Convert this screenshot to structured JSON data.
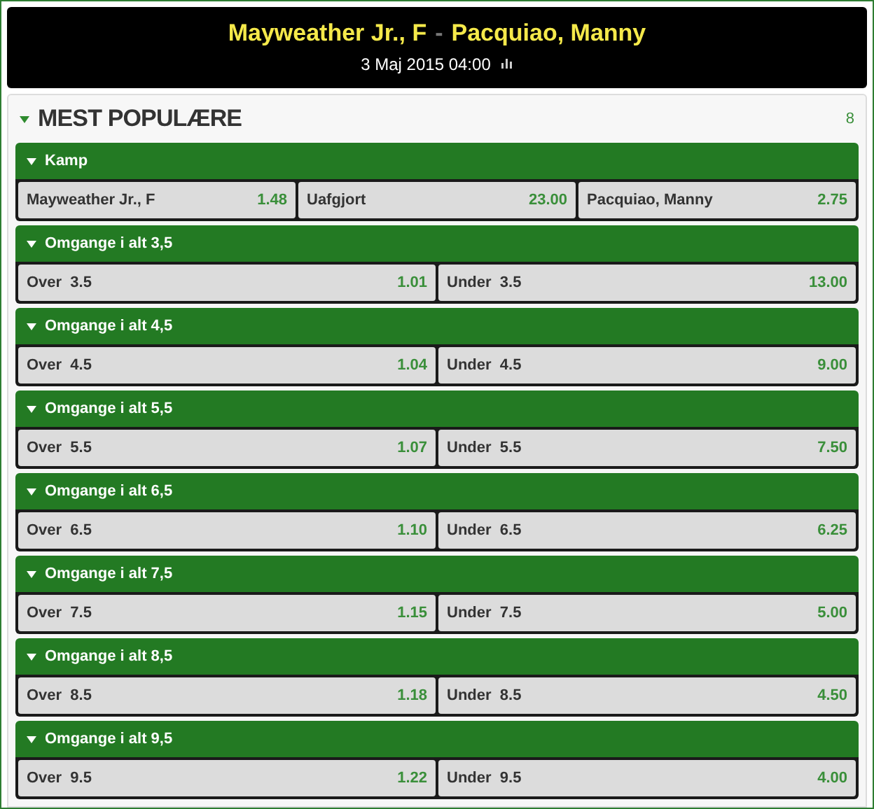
{
  "event": {
    "home": "Mayweather Jr., F",
    "separator": "-",
    "away": "Pacquiao, Manny",
    "date": "3 Maj 2015 04:00"
  },
  "section": {
    "title": "MEST POPULÆRE",
    "count": "8",
    "expanded": true
  },
  "markets": [
    {
      "title": "Kamp",
      "expanded": true,
      "outcomes": [
        {
          "label": "Mayweather Jr., F",
          "odds": "1.48"
        },
        {
          "label": "Uafgjort",
          "odds": "23.00"
        },
        {
          "label": "Pacquiao, Manny",
          "odds": "2.75"
        }
      ]
    },
    {
      "title": "Omgange i alt 3,5",
      "expanded": true,
      "outcomes": [
        {
          "label": "Over  3.5",
          "odds": "1.01"
        },
        {
          "label": "Under  3.5",
          "odds": "13.00"
        }
      ]
    },
    {
      "title": "Omgange i alt 4,5",
      "expanded": true,
      "outcomes": [
        {
          "label": "Over  4.5",
          "odds": "1.04"
        },
        {
          "label": "Under  4.5",
          "odds": "9.00"
        }
      ]
    },
    {
      "title": "Omgange i alt 5,5",
      "expanded": true,
      "outcomes": [
        {
          "label": "Over  5.5",
          "odds": "1.07"
        },
        {
          "label": "Under  5.5",
          "odds": "7.50"
        }
      ]
    },
    {
      "title": "Omgange i alt 6,5",
      "expanded": true,
      "outcomes": [
        {
          "label": "Over  6.5",
          "odds": "1.10"
        },
        {
          "label": "Under  6.5",
          "odds": "6.25"
        }
      ]
    },
    {
      "title": "Omgange i alt 7,5",
      "expanded": true,
      "outcomes": [
        {
          "label": "Over  7.5",
          "odds": "1.15"
        },
        {
          "label": "Under  7.5",
          "odds": "5.00"
        }
      ]
    },
    {
      "title": "Omgange i alt 8,5",
      "expanded": true,
      "outcomes": [
        {
          "label": "Over  8.5",
          "odds": "1.18"
        },
        {
          "label": "Under  8.5",
          "odds": "4.50"
        }
      ]
    },
    {
      "title": "Omgange i alt 9,5",
      "expanded": true,
      "outcomes": [
        {
          "label": "Over  9.5",
          "odds": "1.22"
        },
        {
          "label": "Under  9.5",
          "odds": "4.00"
        }
      ]
    }
  ]
}
